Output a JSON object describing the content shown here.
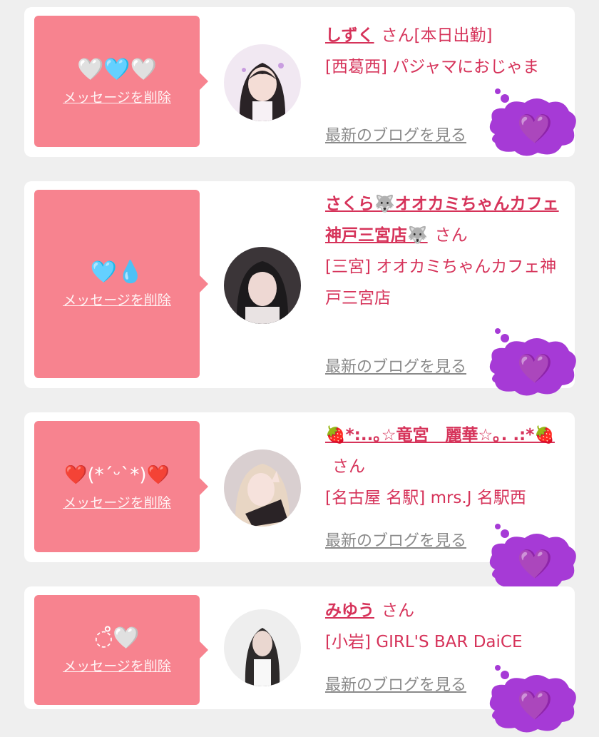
{
  "messages": [
    {
      "emoji": "🤍🩵🤍",
      "delete_label": "メッセージを削除",
      "name": "しずく",
      "suffix": "さん[本日出勤]",
      "shop": "[西葛西] パジャマにおじゃま",
      "blog_label": "最新のブログを見る",
      "stamp": "💜"
    },
    {
      "emoji": "🩵💧",
      "delete_label": "メッセージを削除",
      "name": "さくら🐺オオカミちゃんカフェ神戸三宮店🐺",
      "suffix": "さん",
      "shop": "[三宮] オオカミちゃんカフェ神戸三宮店",
      "blog_label": "最新のブログを見る",
      "stamp": "💜"
    },
    {
      "emoji": "❤️(*´ᵕ`*)❤️",
      "delete_label": "メッセージを削除",
      "name": "🍓*:..｡☆竜宮　麗華☆｡. .:*🍓",
      "suffix": "さん",
      "shop": "[名古屋 名駅] mrs.J 名駅西",
      "blog_label": "最新のブログを見る",
      "stamp": "💜"
    },
    {
      "emoji": "◌̊🤍",
      "delete_label": "メッセージを削除",
      "name": "みゆう",
      "suffix": "さん",
      "shop": "[小岩] GIRL'S BAR DaiCE",
      "blog_label": "最新のブログを見る",
      "stamp": "💜"
    }
  ],
  "colors": {
    "bubble": "#f7838f",
    "name": "#d6335a",
    "stamp": "#a63ad6"
  }
}
